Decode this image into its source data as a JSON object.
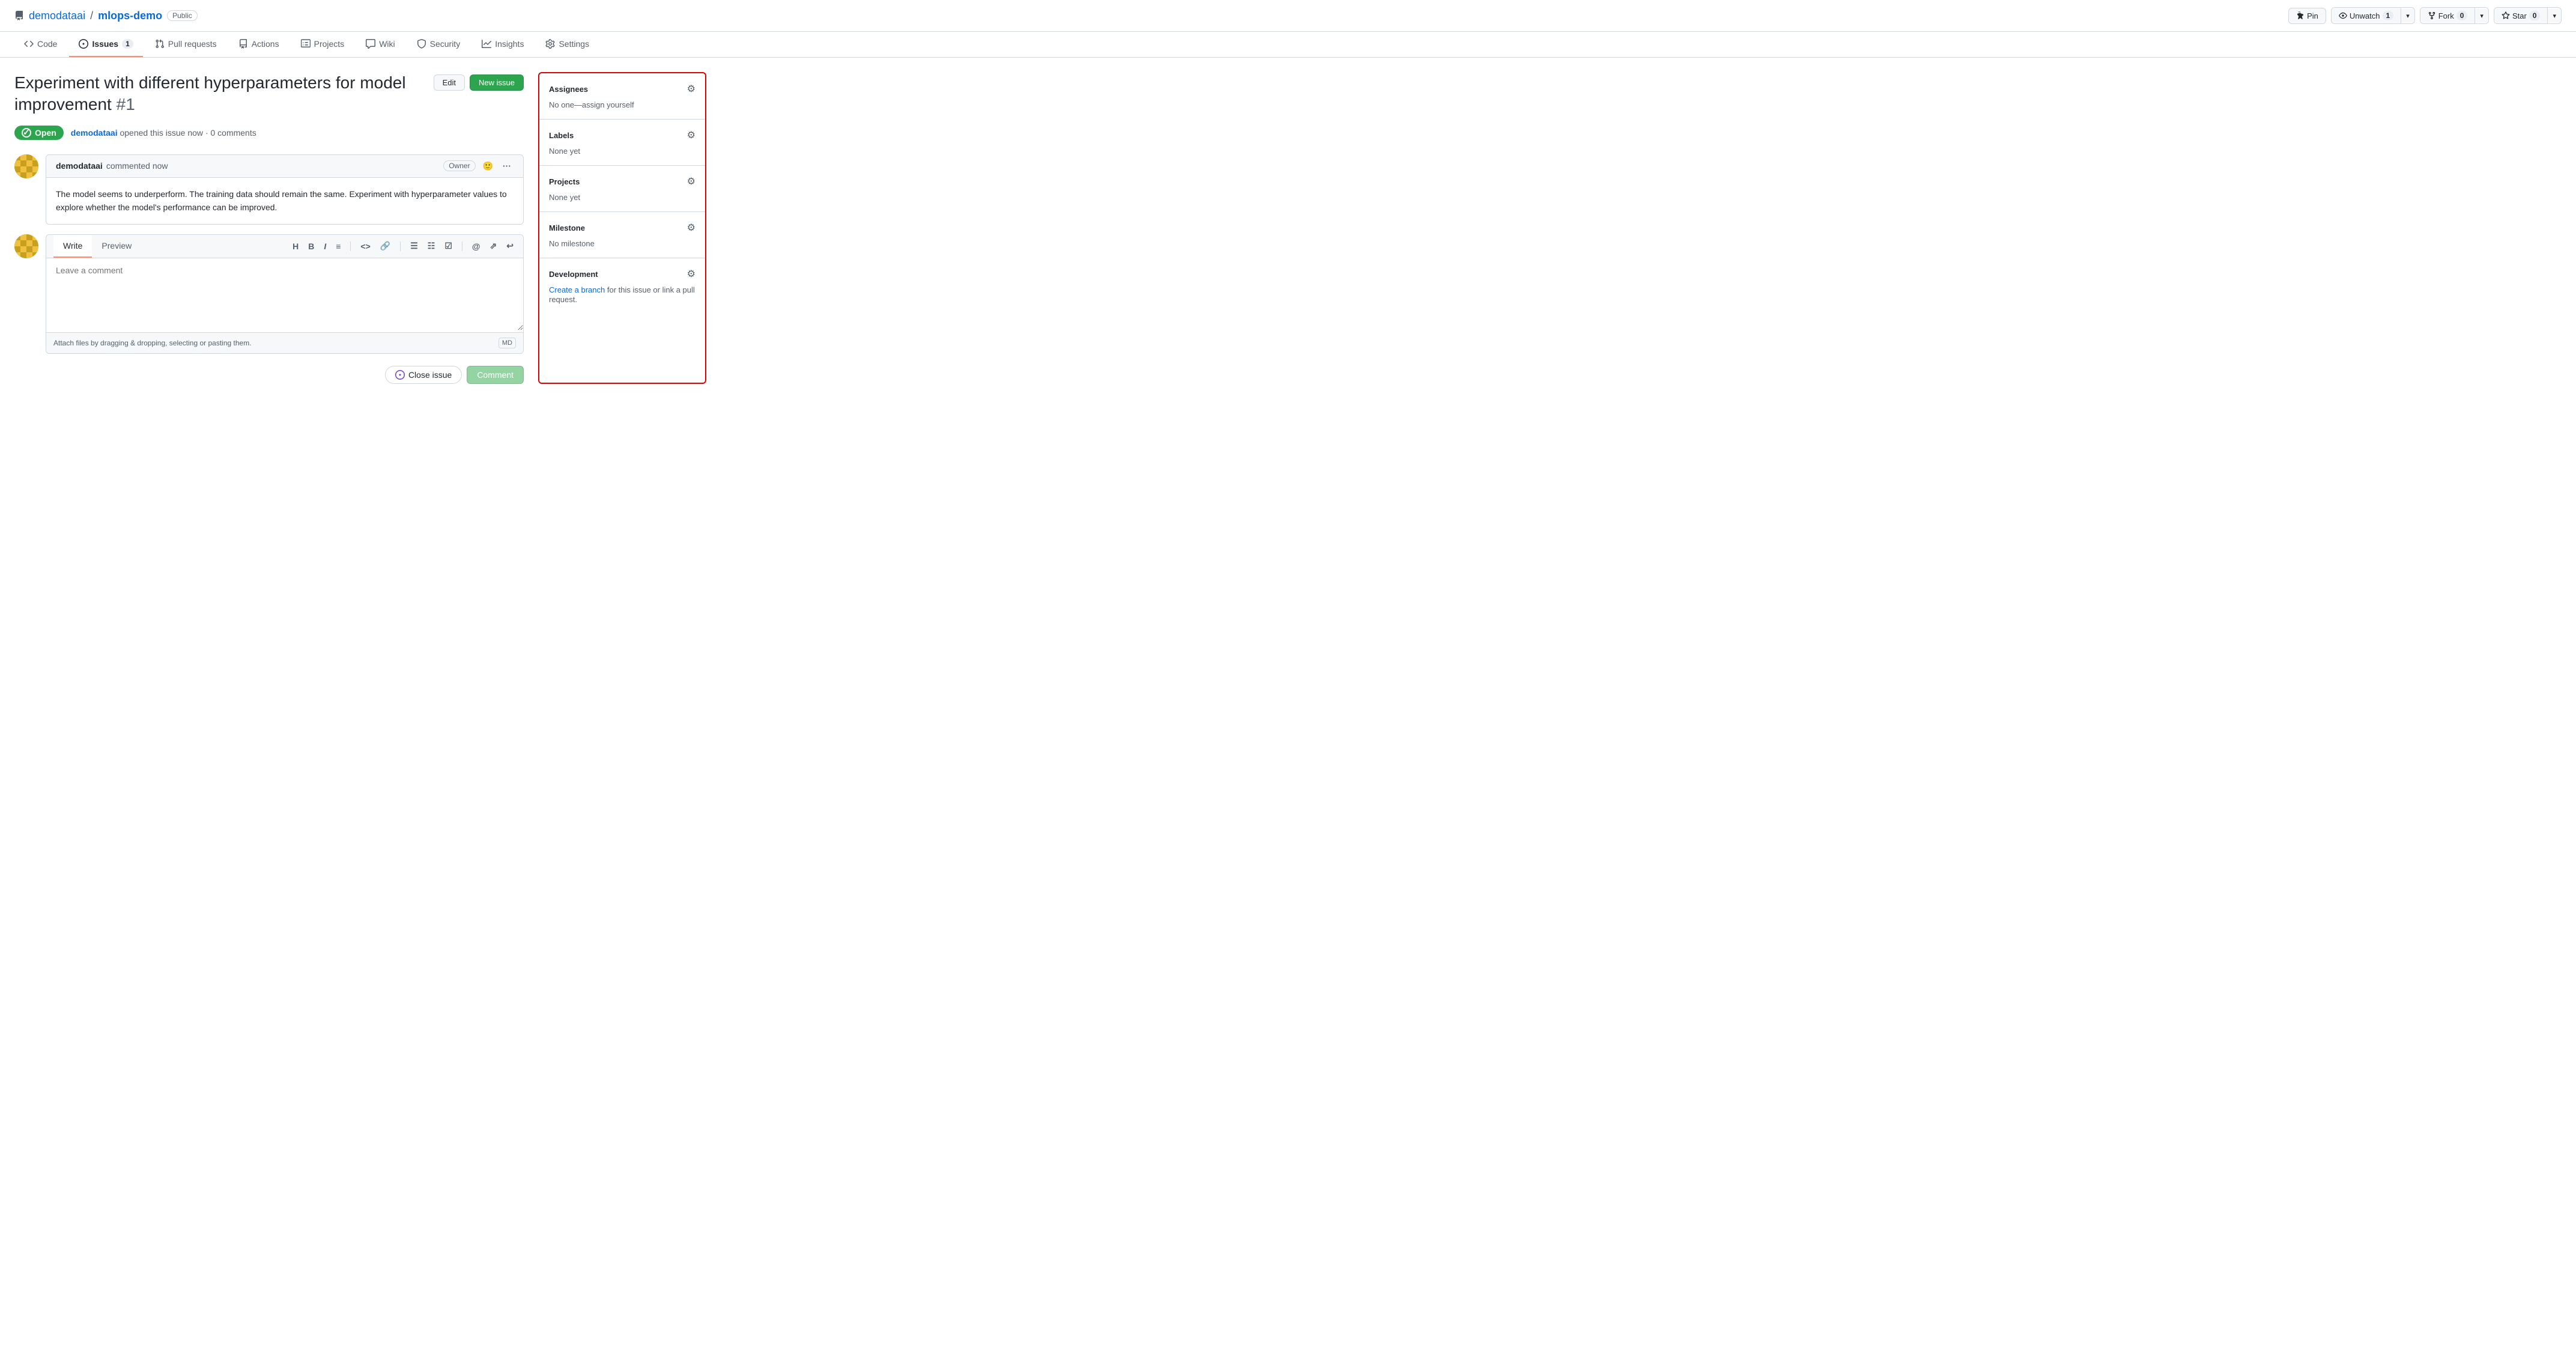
{
  "repo": {
    "org": "demodataai",
    "name": "mlops-demo",
    "visibility": "Public",
    "url": "#"
  },
  "actions": {
    "pin_label": "Pin",
    "unwatch_label": "Unwatch",
    "unwatch_count": "1",
    "fork_label": "Fork",
    "fork_count": "0",
    "star_label": "Star",
    "star_count": "0"
  },
  "nav": {
    "tabs": [
      {
        "id": "code",
        "label": "Code",
        "badge": null,
        "active": false
      },
      {
        "id": "issues",
        "label": "Issues",
        "badge": "1",
        "active": true
      },
      {
        "id": "pull-requests",
        "label": "Pull requests",
        "badge": null,
        "active": false
      },
      {
        "id": "actions",
        "label": "Actions",
        "badge": null,
        "active": false
      },
      {
        "id": "projects",
        "label": "Projects",
        "badge": null,
        "active": false
      },
      {
        "id": "wiki",
        "label": "Wiki",
        "badge": null,
        "active": false
      },
      {
        "id": "security",
        "label": "Security",
        "badge": null,
        "active": false
      },
      {
        "id": "insights",
        "label": "Insights",
        "badge": null,
        "active": false
      },
      {
        "id": "settings",
        "label": "Settings",
        "badge": null,
        "active": false
      }
    ]
  },
  "issue": {
    "title": "Experiment with different hyperparameters for model improvement",
    "number": "#1",
    "status": "Open",
    "author": "demodataai",
    "time": "now",
    "comment_count": "0 comments",
    "edit_label": "Edit",
    "new_issue_label": "New issue"
  },
  "comment": {
    "author": "demodataai",
    "time": "commented now",
    "owner_badge": "Owner",
    "body": "The model seems to underperform. The training data should remain the same. Experiment with hyperparameter values to explore whether the model's performance can be improved."
  },
  "write_area": {
    "write_tab": "Write",
    "preview_tab": "Preview",
    "placeholder": "Leave a comment",
    "attach_text": "Attach files by dragging & dropping, selecting or pasting them.",
    "close_label": "Close issue",
    "comment_label": "Comment"
  },
  "sidebar": {
    "assignees": {
      "title": "Assignees",
      "value": "No one—assign yourself"
    },
    "labels": {
      "title": "Labels",
      "value": "None yet"
    },
    "projects": {
      "title": "Projects",
      "value": "None yet"
    },
    "milestone": {
      "title": "Milestone",
      "value": "No milestone"
    },
    "development": {
      "title": "Development",
      "link_text": "Create a branch",
      "suffix": " for this issue or link a pull request."
    }
  }
}
